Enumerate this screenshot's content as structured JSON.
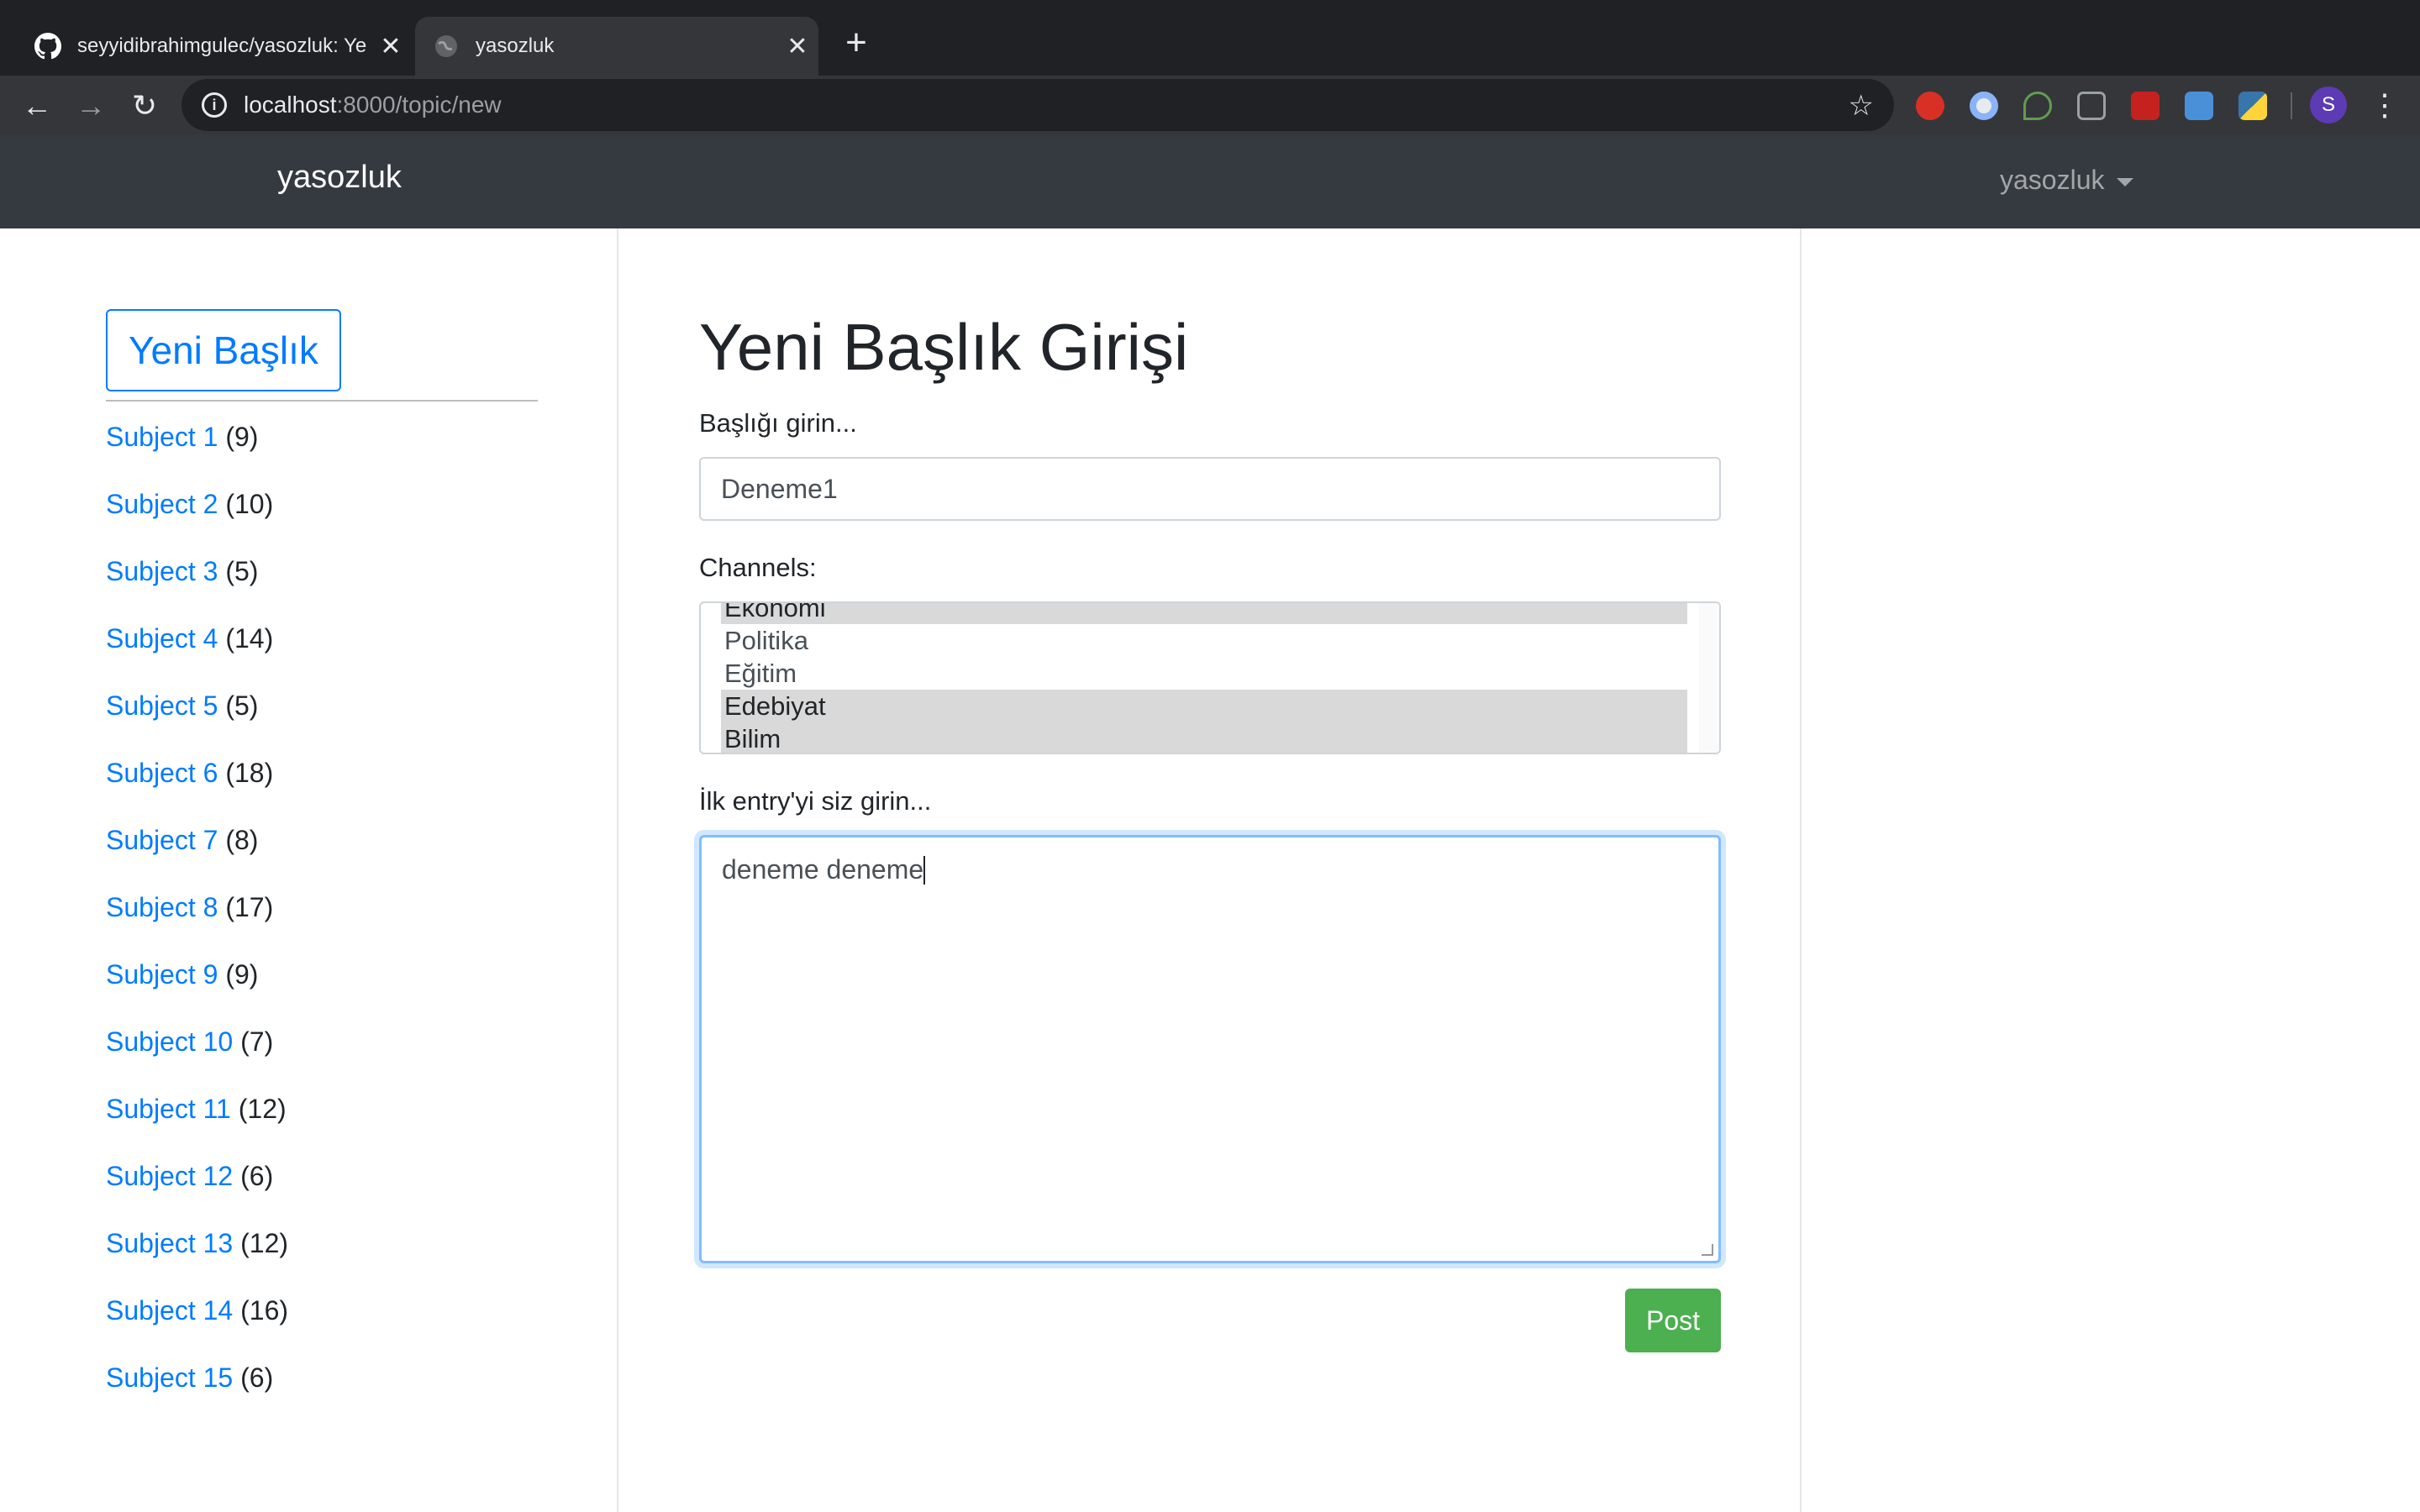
{
  "browser": {
    "tabs": [
      {
        "title": "seyyidibrahimgulec/yasozluk: Ye",
        "favicon": "github-icon",
        "active": false
      },
      {
        "title": "yasozluk",
        "favicon": "globe-icon",
        "active": true
      }
    ],
    "address": {
      "host": "localhost",
      "path": ":8000/topic/new"
    },
    "profile_initial": "S"
  },
  "navbar": {
    "brand": "yasozluk",
    "user_menu": "yasozluk"
  },
  "sidebar": {
    "new_topic_button": "Yeni Başlık",
    "subjects": [
      {
        "name": "Subject 1",
        "count": "(9)"
      },
      {
        "name": "Subject 2",
        "count": "(10)"
      },
      {
        "name": "Subject 3",
        "count": "(5)"
      },
      {
        "name": "Subject 4",
        "count": "(14)"
      },
      {
        "name": "Subject 5",
        "count": "(5)"
      },
      {
        "name": "Subject 6",
        "count": "(18)"
      },
      {
        "name": "Subject 7",
        "count": "(8)"
      },
      {
        "name": "Subject 8",
        "count": "(17)"
      },
      {
        "name": "Subject 9",
        "count": "(9)"
      },
      {
        "name": "Subject 10",
        "count": "(7)"
      },
      {
        "name": "Subject 11",
        "count": "(12)"
      },
      {
        "name": "Subject 12",
        "count": "(6)"
      },
      {
        "name": "Subject 13",
        "count": "(12)"
      },
      {
        "name": "Subject 14",
        "count": "(16)"
      },
      {
        "name": "Subject 15",
        "count": "(6)"
      }
    ]
  },
  "form": {
    "title": "Yeni Başlık Girişi",
    "topic_label": "Başlığı girin...",
    "topic_value": "Deneme1",
    "channels_label": "Channels:",
    "channels": [
      {
        "name": "Ekonomi",
        "selected": true
      },
      {
        "name": "Politika",
        "selected": false
      },
      {
        "name": "Eğitim",
        "selected": false
      },
      {
        "name": "Edebiyat",
        "selected": true
      },
      {
        "name": "Bilim",
        "selected": true
      }
    ],
    "entry_label": "İlk entry'yi siz girin...",
    "entry_value": "deneme deneme",
    "submit": "Post"
  },
  "colors": {
    "primary": "#007bff",
    "success": "#4caf50",
    "navbar": "#343a40"
  }
}
